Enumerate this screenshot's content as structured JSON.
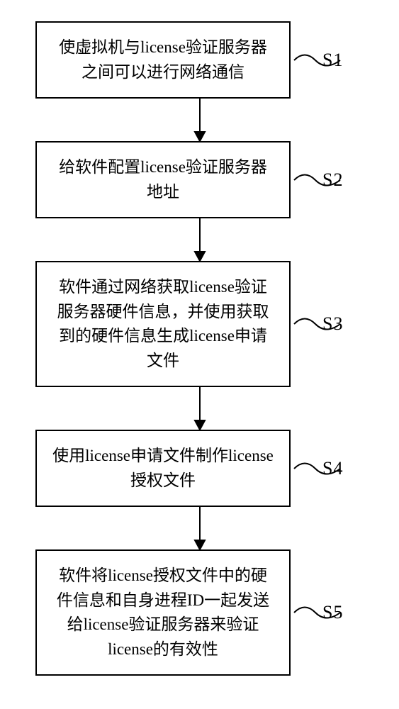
{
  "flowchart": {
    "steps": [
      {
        "label": "S1",
        "text": "使虚拟机与license验证服务器之间可以进行网络通信"
      },
      {
        "label": "S2",
        "text": "给软件配置license验证服务器地址"
      },
      {
        "label": "S3",
        "text": "软件通过网络获取license验证服务器硬件信息，并使用获取到的硬件信息生成license申请文件"
      },
      {
        "label": "S4",
        "text": "使用license申请文件制作license授权文件"
      },
      {
        "label": "S5",
        "text": "软件将license授权文件中的硬件信息和自身进程ID一起发送给license验证服务器来验证license的有效性"
      }
    ]
  }
}
